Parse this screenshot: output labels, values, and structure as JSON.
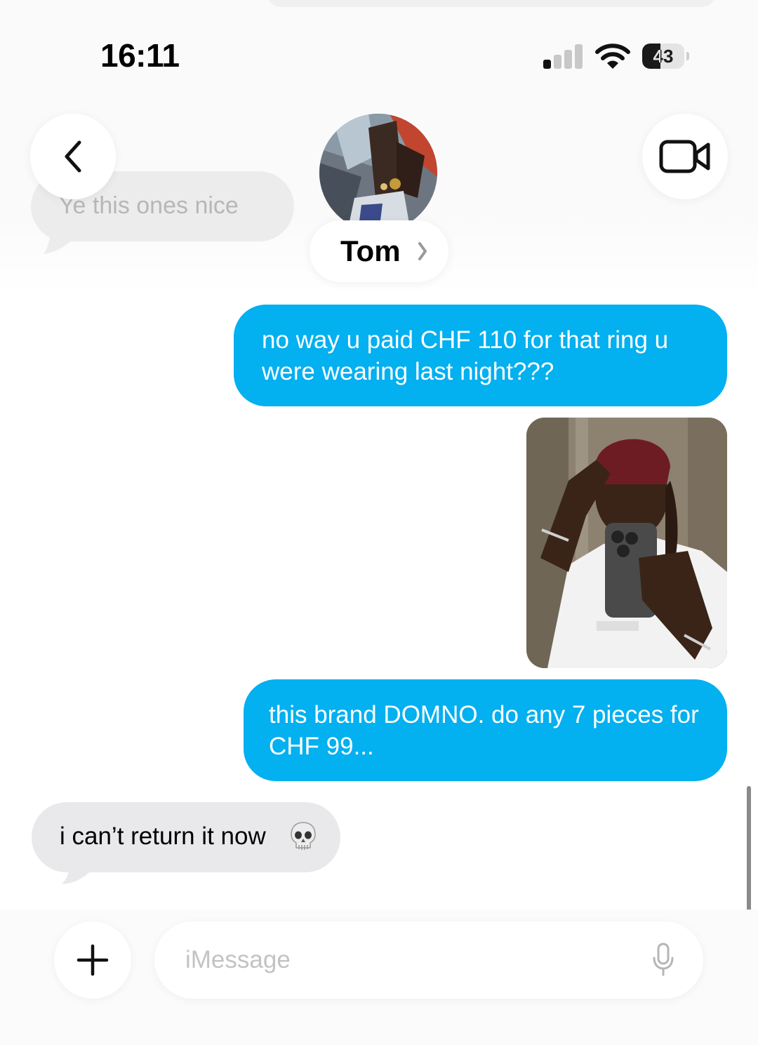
{
  "status_bar": {
    "time": "16:11",
    "battery_level": "43",
    "signal_bars_active": 1,
    "signal_bars_total": 4
  },
  "header": {
    "contact_name": "Tom",
    "faded_previous_message": "Ye this ones nice"
  },
  "messages": [
    {
      "direction": "outgoing",
      "type": "text",
      "text": "no way u paid CHF 110 for that ring u were wearing last night???"
    },
    {
      "direction": "outgoing",
      "type": "image",
      "image_icon": "photo-selfie-icon"
    },
    {
      "direction": "outgoing",
      "type": "text",
      "text": "this brand DOMNO. do any 7 pieces for CHF 99..."
    },
    {
      "direction": "incoming",
      "type": "text",
      "text": "i can’t return it now",
      "emoji_icon": "skull-emoji-icon"
    }
  ],
  "composer": {
    "placeholder": "iMessage"
  },
  "colors": {
    "outgoing_bubble": "#03b0f0",
    "incoming_bubble": "#e9e9eb",
    "background": "#ffffff"
  }
}
